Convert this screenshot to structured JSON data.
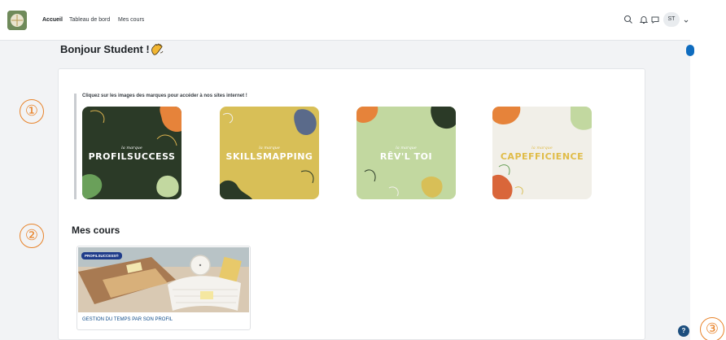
{
  "navbar": {
    "links": [
      "Accueil",
      "Tableau de bord",
      "Mes cours"
    ],
    "user_initials": "ST",
    "icons": [
      "search-icon",
      "bell-icon",
      "chat-icon",
      "chevron-down-icon"
    ]
  },
  "greeting": {
    "text": "Bonjour Student !",
    "emoji": "waving-hand-icon"
  },
  "brands": {
    "caption": "Cliquez sur les images des marques pour accéder à nos sites internet !",
    "items": [
      {
        "small": "la marque",
        "name": "PROFILSUCCESS",
        "bg": "#2b3a27",
        "text_color": "#ffffff"
      },
      {
        "small": "la marque",
        "name": "SKILLSMAPPING",
        "bg": "#d8bf57",
        "text_color": "#ffffff"
      },
      {
        "small": "la marque",
        "name": "RÊV'L TOI",
        "bg": "#c2d8a0",
        "text_color": "#ffffff"
      },
      {
        "small": "la marque",
        "name": "CAPEFFICIENCE",
        "bg": "#f1efe8",
        "text_color": "#e0bc48"
      }
    ]
  },
  "courses": {
    "title": "Mes cours",
    "items": [
      {
        "badge": "PROFILSUCCESS®",
        "name": "GESTION DU TEMPS PAR SON PROFIL"
      }
    ]
  },
  "markers": [
    "①",
    "②",
    "③"
  ],
  "help_label": "?",
  "colors": {
    "accent_blue": "#0f6cbf",
    "marker_orange": "#e8832a",
    "badge_blue": "#1f3c8a"
  }
}
